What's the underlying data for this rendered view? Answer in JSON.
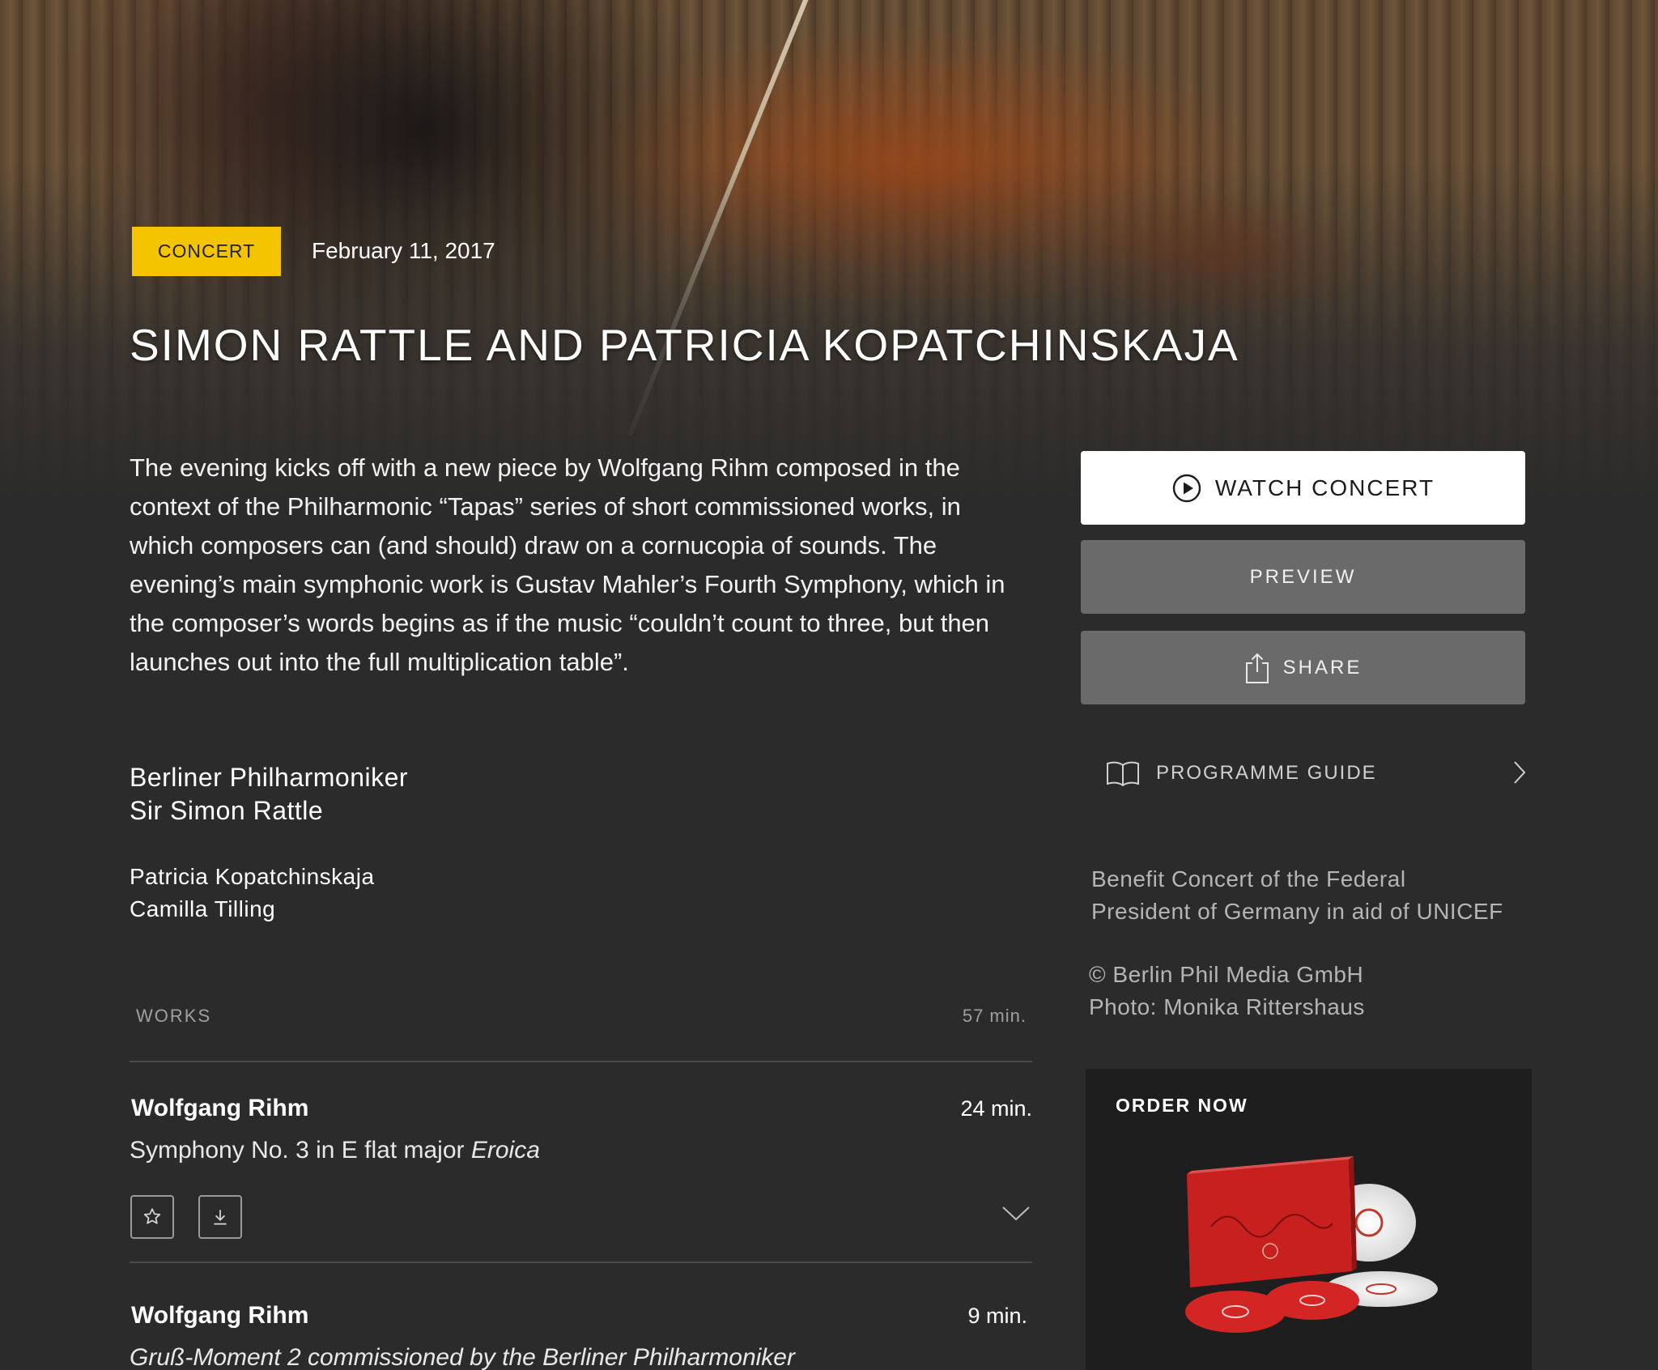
{
  "hero": {
    "badge": "CONCERT",
    "date": "February 11, 2017",
    "title": "SIMON RATTLE AND PATRICIA KOPATCHINSKAJA"
  },
  "description": "The evening kicks off with a new piece by Wolfgang Rihm composed in the context of the Philharmonic “Tapas” series of short commissioned works, in which composers can (and should) draw on a cornucopia of sounds. The evening’s main symphonic work is Gustav Mahler’s Fourth Symphony, which in the composer’s words begins as if the music “couldn’t count to three, but then launches out into the full multiplication table”.",
  "performers": {
    "orchestra": "Berliner Philharmoniker",
    "conductor": "Sir Simon Rattle",
    "soloist1": "Patricia Kopatchinskaja",
    "soloist2": "Camilla Tilling"
  },
  "works": {
    "label": "WORKS",
    "total_duration": "57 min.",
    "items": [
      {
        "composer": "Wolfgang Rihm",
        "duration": "24 min.",
        "title_plain": "Symphony No. 3 in E flat major ",
        "title_italic": "Eroica",
        "favorite_icon": "star-icon",
        "download_icon": "download-icon",
        "expand_icon": "chevron-down-icon"
      },
      {
        "composer": "Wolfgang Rihm",
        "duration": "9 min.",
        "title_italic": "Gruß-Moment 2 commissioned by the Berliner Philharmoniker"
      }
    ]
  },
  "actions": {
    "watch": "WATCH CONCERT",
    "preview": "PREVIEW",
    "share": "SHARE",
    "guide": "PROGRAMME GUIDE"
  },
  "sidebar": {
    "benefit_line1": "Benefit Concert of the Federal",
    "benefit_line2": "President of Germany in aid of UNICEF",
    "copyright": "© Berlin Phil Media GmbH",
    "photo": "Photo: Monika Rittershaus",
    "order_label": "ORDER NOW"
  },
  "colors": {
    "badge": "#f5c400",
    "background": "#2b2b2b",
    "secondary_button": "#6a6a6a"
  }
}
